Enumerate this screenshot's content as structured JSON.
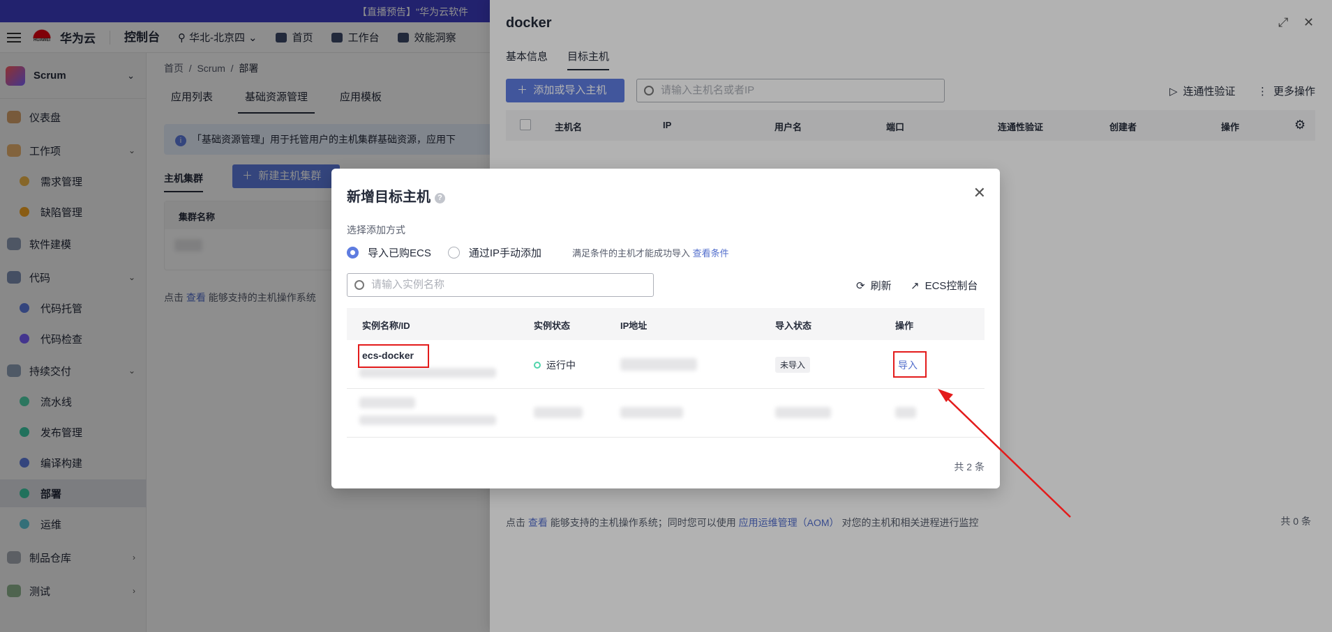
{
  "banner": {
    "text": "【直播预告】\"华为云软件"
  },
  "header": {
    "brand": "华为云",
    "console": "控制台",
    "region": "华北-北京四",
    "links": [
      "首页",
      "工作台",
      "效能洞察"
    ]
  },
  "sidebar": {
    "project": "Scrum",
    "items": [
      {
        "label": "仪表盘"
      },
      {
        "label": "工作项"
      },
      {
        "label": "需求管理"
      },
      {
        "label": "缺陷管理"
      },
      {
        "label": "软件建模"
      },
      {
        "label": "代码"
      },
      {
        "label": "代码托管"
      },
      {
        "label": "代码检查"
      },
      {
        "label": "持续交付"
      },
      {
        "label": "流水线"
      },
      {
        "label": "发布管理"
      },
      {
        "label": "编译构建"
      },
      {
        "label": "部署"
      },
      {
        "label": "运维"
      },
      {
        "label": "制品仓库"
      },
      {
        "label": "测试"
      }
    ]
  },
  "main": {
    "breadcrumb": [
      "首页",
      "Scrum",
      "部署"
    ],
    "tabs": [
      "应用列表",
      "基础资源管理",
      "应用模板"
    ],
    "info": "「基础资源管理」用于托管用户的主机集群基础资源，应用下",
    "subtab": "主机集群",
    "create_label": "新建主机集群",
    "col_name": "集群名称",
    "note_prefix": "点击",
    "note_link": "查看",
    "note_suffix": "能够支持的主机操作系统"
  },
  "drawer": {
    "title": "docker",
    "tabs": [
      "基本信息",
      "目标主机"
    ],
    "add_label": "添加或导入主机",
    "search_placeholder": "请输入主机名或者IP",
    "verify_label": "连通性验证",
    "more_label": "更多操作",
    "columns": [
      "主机名",
      "IP",
      "用户名",
      "端口",
      "连通性验证",
      "创建者",
      "操作"
    ],
    "note_prefix": "点击",
    "note_link1": "查看",
    "note_mid": "能够支持的主机操作系统；同时您可以使用",
    "note_link2": "应用运维管理（AOM）",
    "note_suffix": "对您的主机和相关进程进行监控",
    "total": "共 0 条"
  },
  "modal": {
    "title": "新增目标主机",
    "method_label": "选择添加方式",
    "option1": "导入已购ECS",
    "option2": "通过IP手动添加",
    "condition_text": "满足条件的主机才能成功导入",
    "condition_link": "查看条件",
    "search_placeholder": "请输入实例名称",
    "refresh_label": "刷新",
    "ecs_label": "ECS控制台",
    "columns": [
      "实例名称/ID",
      "实例状态",
      "IP地址",
      "导入状态",
      "操作"
    ],
    "rows": [
      {
        "name": "ecs-docker",
        "status": "运行中",
        "import_status": "未导入",
        "action": "导入"
      }
    ],
    "total": "共 2 条"
  },
  "colors": {
    "primary": "#5e7ce0",
    "annotation": "#e31b1b",
    "banner": "#3f3ec6"
  }
}
